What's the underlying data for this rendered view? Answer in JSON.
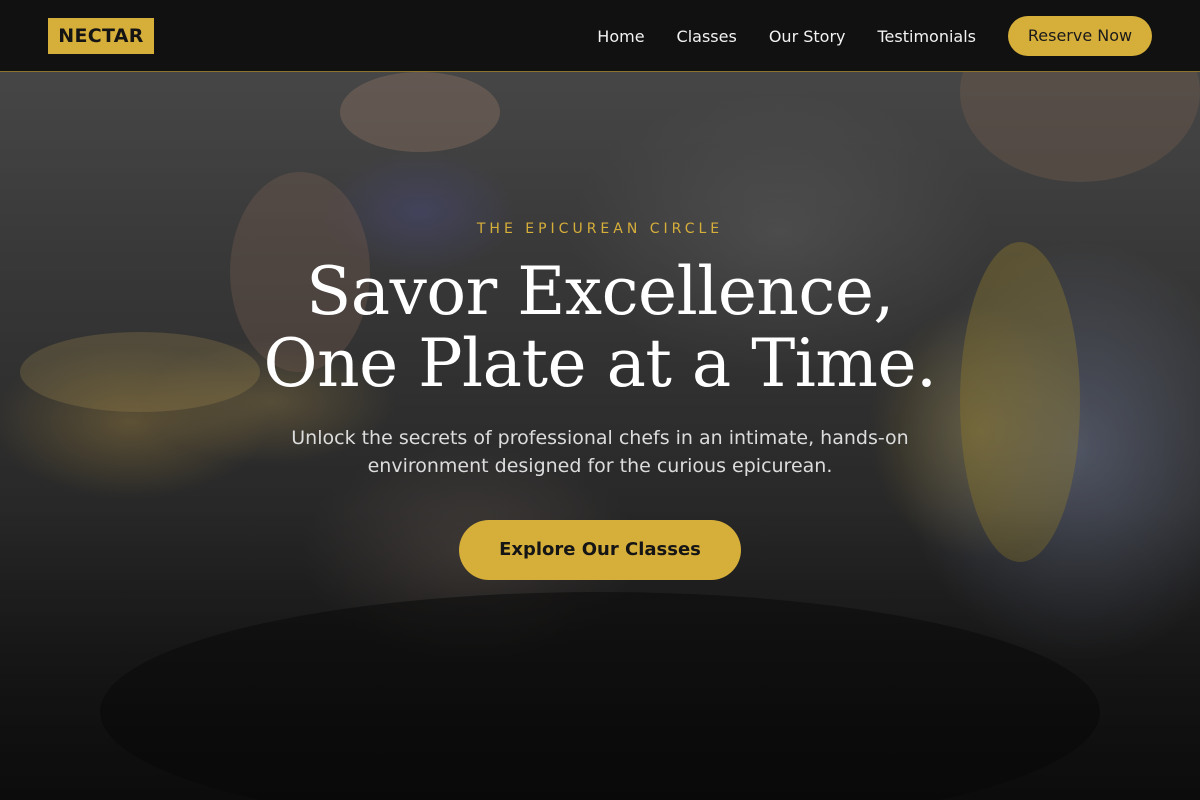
{
  "nav": {
    "logo": "NECTAR",
    "links": [
      "Home",
      "Classes",
      "Our Story",
      "Testimonials"
    ],
    "reserve_label": "Reserve Now"
  },
  "hero": {
    "eyebrow": "THE EPICUREAN CIRCLE",
    "headline_line1": "Savor Excellence,",
    "headline_line2": "One Plate at a Time.",
    "subtitle": "Unlock the secrets of professional chefs in an intimate, hands-on environment designed for the curious epicurean.",
    "cta_label": "Explore Our Classes"
  },
  "colors": {
    "accent": "#d6ae3a",
    "nav_background": "#111111",
    "text_light": "#ffffff"
  }
}
